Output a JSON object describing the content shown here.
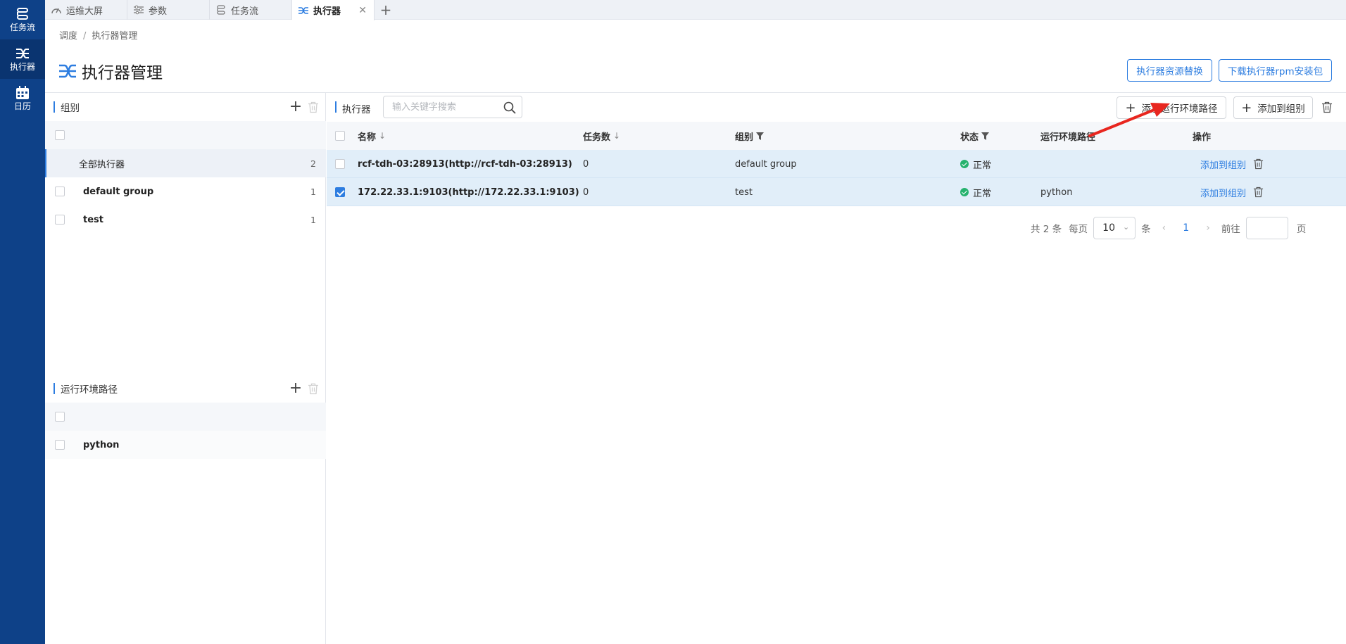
{
  "leftnav": {
    "items": [
      {
        "label": "任务流",
        "icon": "workflow-icon"
      },
      {
        "label": "执行器",
        "icon": "executor-icon"
      },
      {
        "label": "日历",
        "icon": "calendar-icon"
      }
    ],
    "active_index": 1
  },
  "tabs": [
    {
      "label": "运维大屏",
      "icon": "dashboard-icon"
    },
    {
      "label": "参数",
      "icon": "sliders-icon"
    },
    {
      "label": "任务流",
      "icon": "workflow-icon"
    },
    {
      "label": "执行器",
      "icon": "executor-icon",
      "active": true,
      "close": "✕"
    }
  ],
  "tab_add": "+",
  "breadcrumb": {
    "parent": "调度",
    "separator": "/",
    "current": "执行器管理"
  },
  "page": {
    "title": "执行器管理",
    "btn_replace": "执行器资源替换",
    "btn_download": "下载执行器rpm安装包"
  },
  "groups_panel": {
    "title": "组别",
    "items": [
      {
        "name": "全部执行器",
        "count": "2"
      },
      {
        "name": "default group",
        "count": "1"
      },
      {
        "name": "test",
        "count": "1"
      }
    ]
  },
  "env_panel": {
    "title": "运行环境路径",
    "items": [
      {
        "name": "python"
      }
    ]
  },
  "executor_panel": {
    "title": "执行器",
    "search_placeholder": "输入关键字搜索",
    "btn_add_env": "添加运行环境路径",
    "btn_add_group": "添加到组别"
  },
  "table": {
    "headers": {
      "name": "名称",
      "tasks": "任务数",
      "group": "组别",
      "status": "状态",
      "env": "运行环境路径",
      "ops": "操作"
    },
    "rows": [
      {
        "name": "rcf-tdh-03:28913(http://rcf-tdh-03:28913)",
        "tasks": "0",
        "group": "default group",
        "status": "正常",
        "env": "",
        "op": "添加到组别",
        "checked": false
      },
      {
        "name": "172.22.33.1:9103(http://172.22.33.1:9103)",
        "tasks": "0",
        "group": "test",
        "status": "正常",
        "env": "python",
        "op": "添加到组别",
        "checked": true
      }
    ]
  },
  "pagination": {
    "total_text": "共 2 条",
    "per_page_label": "每页",
    "page_size": "10",
    "unit": "条",
    "current_page": "1",
    "goto_label": "前往",
    "page_unit": "页",
    "prev": "‹",
    "next": "›"
  },
  "colors": {
    "nav_bg": "#0e4188",
    "accent": "#2d7de0",
    "selected_row": "#e1eef9",
    "status_ok": "#26b26e",
    "annotation": "#e8261f"
  }
}
